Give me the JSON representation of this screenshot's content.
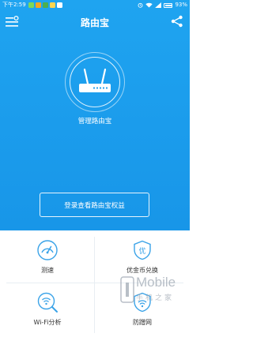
{
  "status_bar": {
    "time": "下午2:59",
    "battery": "93%",
    "notification_colors": [
      "#7ed957",
      "#f5a623",
      "#4caf50",
      "#ffd54f",
      "#ffffff"
    ]
  },
  "header": {
    "title": "路由宝"
  },
  "hero": {
    "manage_label": "管理路由宝",
    "login_button": "登录查看路由宝权益"
  },
  "grid": {
    "items": [
      {
        "label": "测速",
        "icon": "speedometer-icon"
      },
      {
        "label": "优金币兑换",
        "icon": "coin-exchange-icon"
      },
      {
        "label": "Wi-Fi分析",
        "icon": "wifi-analysis-icon"
      },
      {
        "label": "防蹭网",
        "icon": "shield-icon"
      }
    ]
  },
  "watermark": {
    "main": "Mobile",
    "sub": "手机之家"
  },
  "colors": {
    "primary": "#1b9cec",
    "icon_blue": "#3aa3e8",
    "text_dark": "#333333"
  }
}
